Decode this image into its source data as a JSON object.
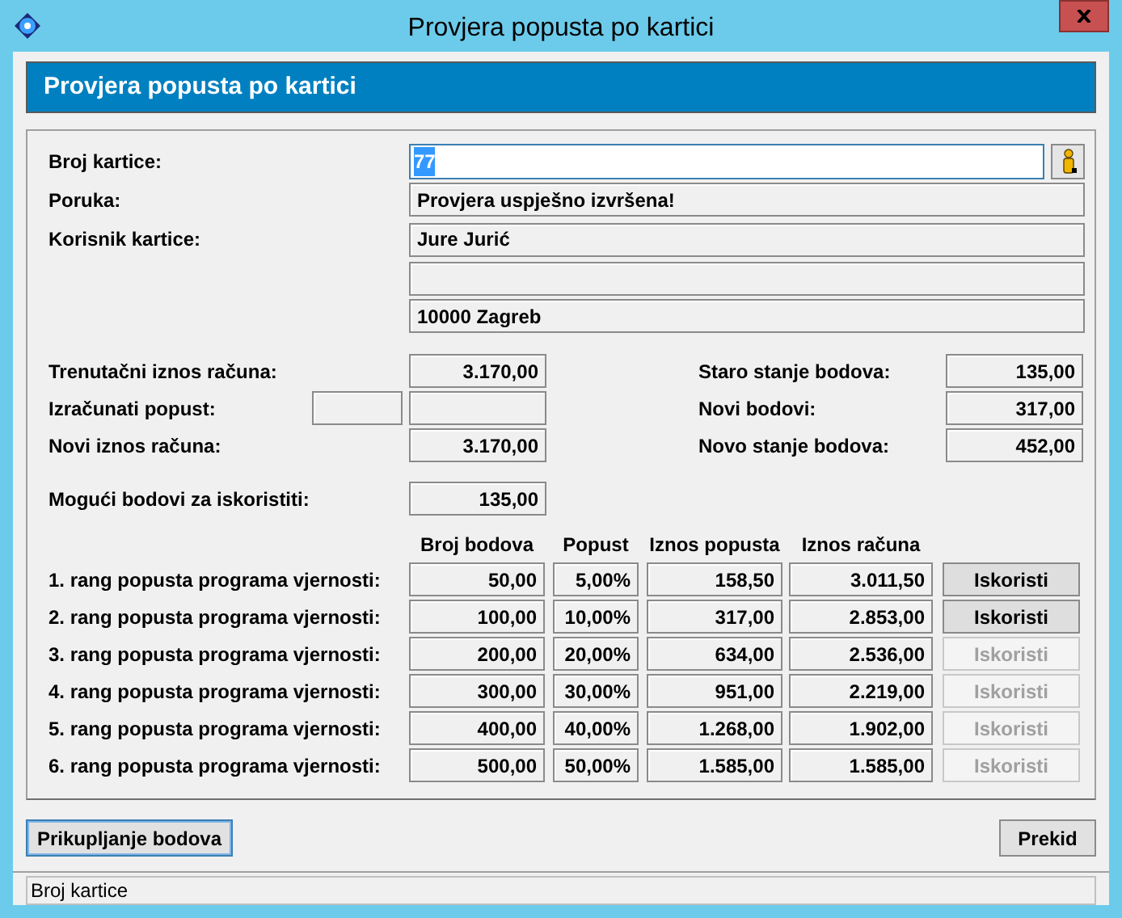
{
  "window": {
    "title": "Provjera popusta po kartici"
  },
  "header": {
    "title": "Provjera popusta po kartici"
  },
  "card": {
    "label": "Broj kartice:",
    "value": "77",
    "text_selected": true
  },
  "message": {
    "label": "Poruka:",
    "value": "Provjera uspješno izvršena!"
  },
  "holder": {
    "label": "Korisnik kartice:",
    "lines": [
      {
        "kind": "text",
        "text": "Jure Jurić"
      },
      {
        "kind": "blank"
      },
      {
        "kind": "text",
        "text": "10000 Zagreb"
      }
    ]
  },
  "totals_left": [
    {
      "label": "Trenutačni iznos računa:",
      "value": "3.170,00",
      "kind": "single"
    },
    {
      "label": "Izračunati popust:",
      "kind": "double"
    },
    {
      "label": "Novi iznos računa:",
      "value": "3.170,00",
      "kind": "single"
    }
  ],
  "totals_right": [
    {
      "label": "Staro stanje bodova:",
      "value": "135,00"
    },
    {
      "label": "Novi bodovi:",
      "value": "317,00"
    },
    {
      "label": "Novo stanje bodova:",
      "value": "452,00"
    }
  ],
  "available": {
    "label": "Mogući bodovi za iskoristiti:",
    "value": "135,00"
  },
  "tiers": {
    "columns": [
      "Broj bodova",
      "Popust",
      "Iznos popusta",
      "Iznos računa"
    ],
    "rows": [
      {
        "label": "1. rang popusta programa vjernosti:",
        "points": "50,00",
        "percent": "5,00%",
        "discount": "158,50",
        "total": "3.011,50",
        "button": "Iskoristi",
        "disabled": false
      },
      {
        "label": "2. rang popusta programa vjernosti:",
        "points": "100,00",
        "percent": "10,00%",
        "discount": "317,00",
        "total": "2.853,00",
        "button": "Iskoristi",
        "disabled": false
      },
      {
        "label": "3. rang popusta programa vjernosti:",
        "points": "200,00",
        "percent": "20,00%",
        "discount": "634,00",
        "total": "2.536,00",
        "button": "Iskoristi",
        "disabled": true
      },
      {
        "label": "4. rang popusta programa vjernosti:",
        "points": "300,00",
        "percent": "30,00%",
        "discount": "951,00",
        "total": "2.219,00",
        "button": "Iskoristi",
        "disabled": true
      },
      {
        "label": "5. rang popusta programa vjernosti:",
        "points": "400,00",
        "percent": "40,00%",
        "discount": "1.268,00",
        "total": "1.902,00",
        "button": "Iskoristi",
        "disabled": true
      },
      {
        "label": "6. rang popusta programa vjernosti:",
        "points": "500,00",
        "percent": "50,00%",
        "discount": "1.585,00",
        "total": "1.585,00",
        "button": "Iskoristi",
        "disabled": true
      }
    ]
  },
  "buttons": [
    {
      "label": "Prikupljanje bodova",
      "focused": true
    },
    {
      "label": "Prekid",
      "focused": false
    }
  ],
  "status_bar": {
    "text": "Broj kartice"
  }
}
